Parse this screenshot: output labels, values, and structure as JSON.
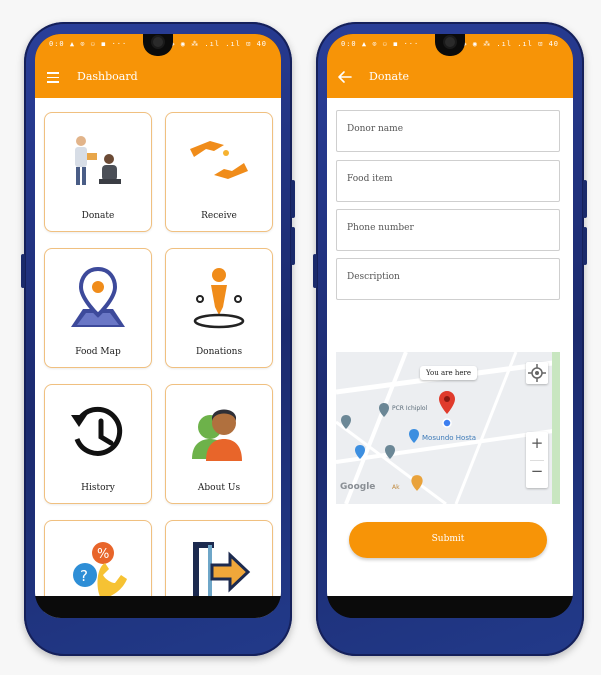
{
  "colors": {
    "accent": "#f79407",
    "phone_frame": "#1f3384",
    "tile_border": "#f0c080"
  },
  "left_phone": {
    "status": {
      "left": "0:0 ▲ ⊙ ⚇ ◼ ···",
      "right": "⊙ ◈ ◉ ⁂ .ıl .ıl ⊡ 40"
    },
    "appbar": {
      "title": "Dashboard",
      "icon": "menu-icon"
    },
    "tiles": [
      {
        "label": "Donate",
        "icon": "donate-icon"
      },
      {
        "label": "Receive",
        "icon": "receive-icon"
      },
      {
        "label": "Food Map",
        "icon": "map-pin-icon"
      },
      {
        "label": "Donations",
        "icon": "donations-icon"
      },
      {
        "label": "History",
        "icon": "history-icon"
      },
      {
        "label": "About Us",
        "icon": "about-us-icon"
      },
      {
        "label": "",
        "icon": "contact-icon"
      },
      {
        "label": "",
        "icon": "logout-icon"
      }
    ]
  },
  "right_phone": {
    "status": {
      "left": "0:0 ▲ ⊙ ⚇ ◼ ···",
      "right": "⊙ ◈ ◉ ⁂ .ıl .ıl ⊡ 40"
    },
    "appbar": {
      "title": "Donate",
      "icon": "back-arrow-icon"
    },
    "form": {
      "donor_name": "Donor name",
      "food_item": "Food item",
      "phone_number": "Phone number",
      "description": "Description"
    },
    "map": {
      "callout": "You are here",
      "place_1": "PCR Ichiplol",
      "place_2": "Mosundo Hosta",
      "place_3": "Google",
      "place_4": "Ak",
      "zoom_in": "+",
      "zoom_out": "−"
    },
    "submit_label": "Submit"
  }
}
